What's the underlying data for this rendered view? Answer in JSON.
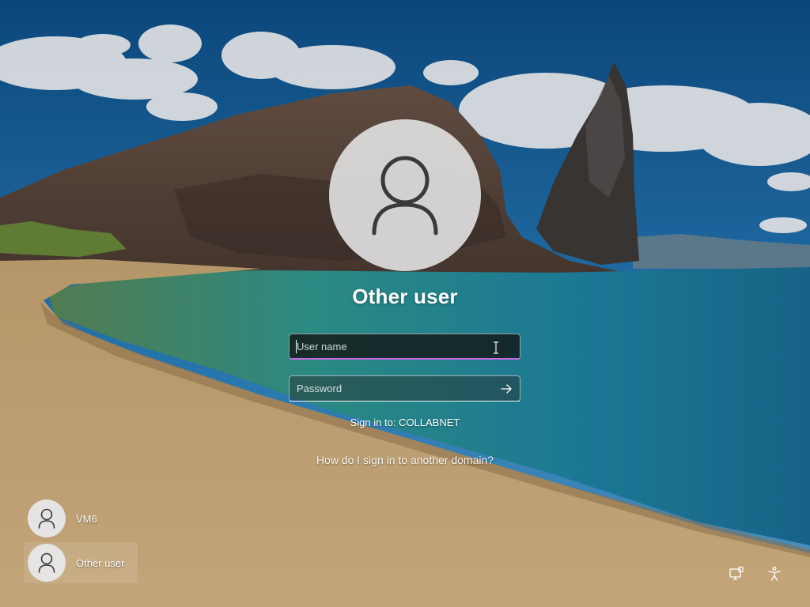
{
  "signin": {
    "title": "Other user",
    "username_placeholder": "User name",
    "username_value": "",
    "password_placeholder": "Password",
    "domain_text": "Sign in to: COLLABNET",
    "help_link": "How do I sign in to another domain?"
  },
  "user_list": [
    {
      "label": "VM6",
      "selected": false
    },
    {
      "label": "Other user",
      "selected": true
    }
  ],
  "icons": {
    "avatar": "person-icon",
    "submit": "arrow-right-icon",
    "network": "network-icon",
    "accessibility": "accessibility-icon"
  },
  "colors": {
    "focus_underline": "#c86be0",
    "avatar_background": "#e2e2e2",
    "text": "#ffffff"
  }
}
